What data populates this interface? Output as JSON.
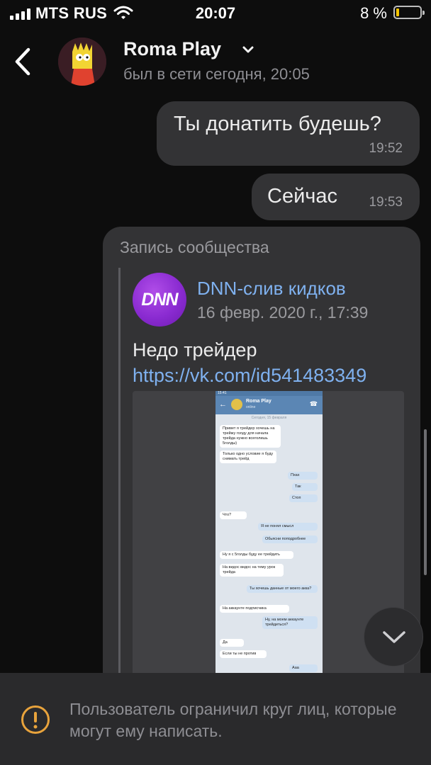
{
  "status_bar": {
    "carrier": "MTS RUS",
    "time": "20:07",
    "battery": "8 %"
  },
  "header": {
    "name": "Roma Play",
    "status": "был в сети сегодня, 20:05"
  },
  "messages": [
    {
      "text": "Ты донатить будешь?",
      "time": "19:52"
    },
    {
      "text": "Сейчас",
      "time": "19:53"
    }
  ],
  "post": {
    "label": "Запись сообщества",
    "community": "DNN-слив кидков",
    "logo_text": "DNN",
    "date": "16 февр. 2020 г., 17:39",
    "text": "Недо трейдер",
    "link": "https://vk.com/id541483349"
  },
  "screenshot": {
    "status": "15:41",
    "name": "Roma Play",
    "sub": "online",
    "date": "Сегодня, 15 февраля",
    "messages": [
      {
        "text": "Привет я трейдер хочешь на трейжу голду для начала трейда нужно всеголишь 5голды)",
        "out": false
      },
      {
        "text": "Только одно условие я буду снимать трейд",
        "out": false
      },
      {
        "text": "Пхах",
        "out": true
      },
      {
        "text": "Так",
        "out": true
      },
      {
        "text": "Стоп",
        "out": true
      },
      {
        "text": "Что?",
        "out": false
      },
      {
        "text": "Я не понял смысл",
        "out": true
      },
      {
        "text": "Обьясни поподробнее",
        "out": true
      },
      {
        "text": "Ну я с 5голды буду ее трейдить",
        "out": false
      },
      {
        "text": "На видос видос на тему урок трейда",
        "out": false
      },
      {
        "text": "Ты хочешь данные от моего акка?",
        "out": true
      },
      {
        "text": "На аккаунте подписчика",
        "out": false
      },
      {
        "text": "Ну, на моем аккаунте трейдиться?",
        "out": true
      },
      {
        "text": "Да",
        "out": false
      },
      {
        "text": "Если ты не против",
        "out": false
      },
      {
        "text": "Ааа",
        "out": true
      }
    ]
  },
  "restriction": {
    "text": "Пользователь ограничил круг лиц, которые могут ему написать."
  },
  "colors": {
    "accent": "#7fb1ef",
    "bubble": "#333335",
    "background": "#0d0d0d",
    "warning": "#e8a33c",
    "battery": "#f5c400"
  },
  "icons": [
    "wifi-icon",
    "battery-icon",
    "back-icon",
    "chevron-down-icon",
    "warning-icon",
    "scroll-down-icon"
  ]
}
